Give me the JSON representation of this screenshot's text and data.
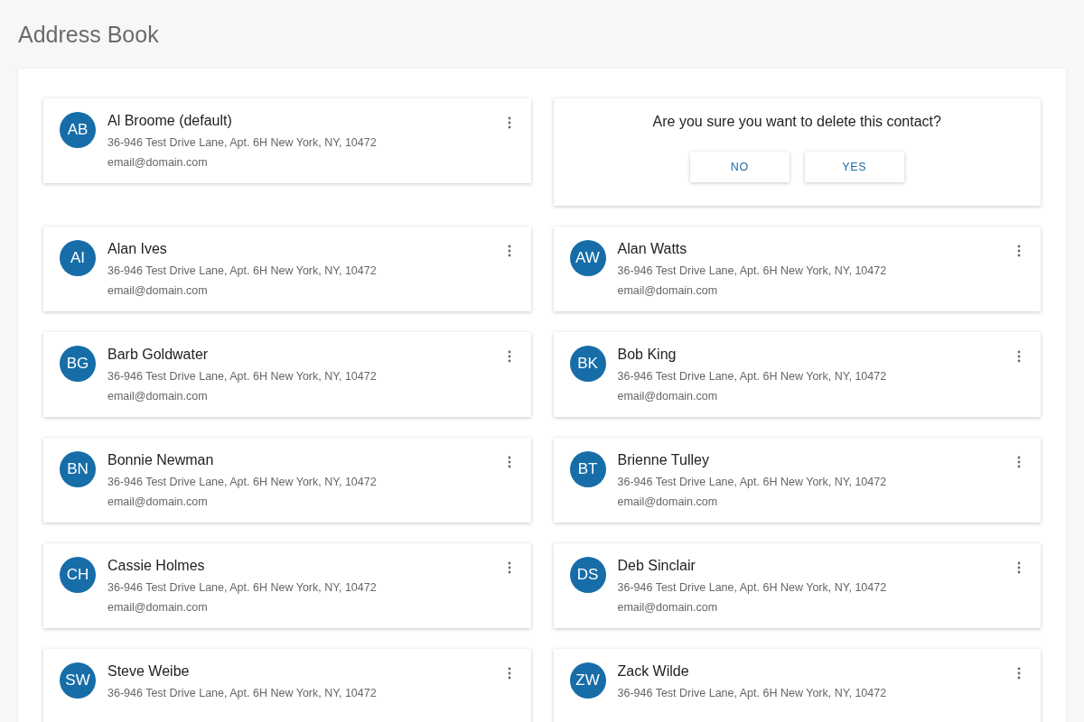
{
  "title": "Address Book",
  "cards": [
    {
      "kind": "contact",
      "initials": "AB",
      "name": "Al Broome (default)",
      "address": "36-946 Test Drive Lane, Apt. 6H New York, NY, 10472",
      "email": "email@domain.com"
    },
    {
      "kind": "confirm",
      "question": "Are you sure you want to delete this contact?",
      "buttons": [
        "NO",
        "YES"
      ]
    },
    {
      "kind": "contact",
      "initials": "AI",
      "name": "Alan Ives",
      "address": "36-946 Test Drive Lane, Apt. 6H New York, NY, 10472",
      "email": "email@domain.com"
    },
    {
      "kind": "contact",
      "initials": "AW",
      "name": "Alan Watts",
      "address": "36-946 Test Drive Lane, Apt. 6H New York, NY, 10472",
      "email": "email@domain.com"
    },
    {
      "kind": "contact",
      "initials": "BG",
      "name": "Barb Goldwater",
      "address": "36-946 Test Drive Lane, Apt. 6H New York, NY, 10472",
      "email": "email@domain.com"
    },
    {
      "kind": "contact",
      "initials": "BK",
      "name": "Bob King",
      "address": "36-946 Test Drive Lane, Apt. 6H New York, NY, 10472",
      "email": "email@domain.com"
    },
    {
      "kind": "contact",
      "initials": "BN",
      "name": "Bonnie Newman",
      "address": "36-946 Test Drive Lane, Apt. 6H New York, NY, 10472",
      "email": "email@domain.com"
    },
    {
      "kind": "contact",
      "initials": "BT",
      "name": "Brienne Tulley",
      "address": "36-946 Test Drive Lane, Apt. 6H New York, NY, 10472",
      "email": "email@domain.com"
    },
    {
      "kind": "contact",
      "initials": "CH",
      "name": "Cassie Holmes",
      "address": "36-946 Test Drive Lane, Apt. 6H New York, NY, 10472",
      "email": "email@domain.com"
    },
    {
      "kind": "contact",
      "initials": "DS",
      "name": "Deb Sinclair",
      "address": "36-946 Test Drive Lane, Apt. 6H New York, NY, 10472",
      "email": "email@domain.com"
    },
    {
      "kind": "contact",
      "initials": "SW",
      "name": "Steve Weibe",
      "address": "36-946 Test Drive Lane, Apt. 6H New York, NY, 10472"
    },
    {
      "kind": "contact",
      "initials": "ZW",
      "name": "Zack Wilde",
      "address": "36-946 Test Drive Lane, Apt. 6H New York, NY, 10472"
    }
  ]
}
